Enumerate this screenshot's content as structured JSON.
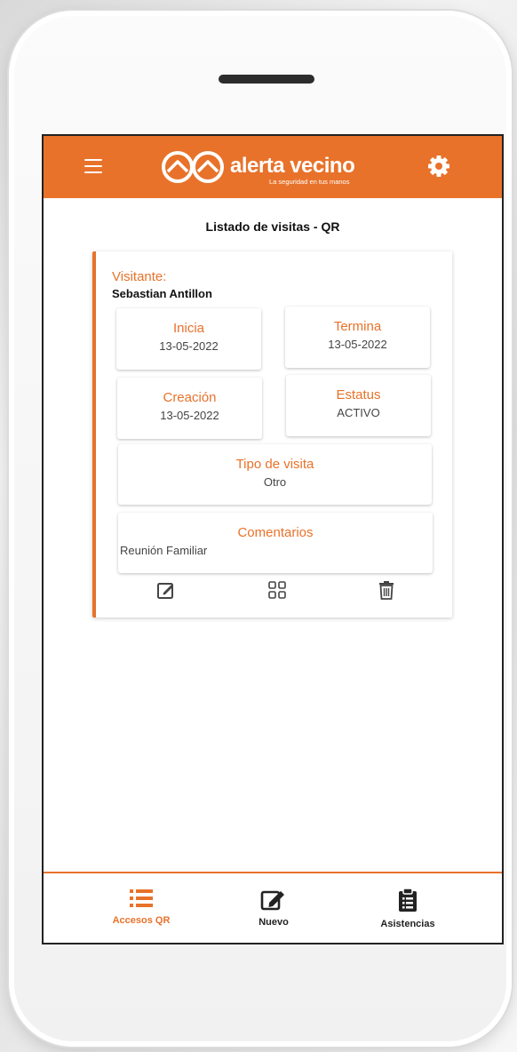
{
  "app": {
    "brand": "alerta vecino",
    "tagline": "La seguridad en tus manos",
    "accent_color": "#e8722a",
    "header_icons": [
      "menu-icon",
      "gear-icon"
    ]
  },
  "page": {
    "title": "Listado de visitas - QR"
  },
  "visit": {
    "visitor_label": "Visitante:",
    "visitor_name": "Sebastian Antillon",
    "start": {
      "label": "Inicia",
      "value": "13-05-2022"
    },
    "end": {
      "label": "Termina",
      "value": "13-05-2022"
    },
    "created": {
      "label": "Creación",
      "value": "13-05-2022"
    },
    "status": {
      "label": "Estatus",
      "value": "ACTIVO"
    },
    "visit_type": {
      "label": "Tipo de visita",
      "value": "Otro"
    },
    "comments": {
      "label": "Comentarios",
      "value": "Reunión Familiar"
    },
    "actions": [
      "edit-icon",
      "qr-grid-icon",
      "trash-icon"
    ]
  },
  "bottom_nav": {
    "items": [
      {
        "label": "Accesos QR",
        "icon": "list-icon",
        "active": true
      },
      {
        "label": "Nuevo",
        "icon": "edit-square-icon",
        "active": false
      },
      {
        "label": "Asistencias",
        "icon": "clipboard-icon",
        "active": false
      }
    ]
  }
}
